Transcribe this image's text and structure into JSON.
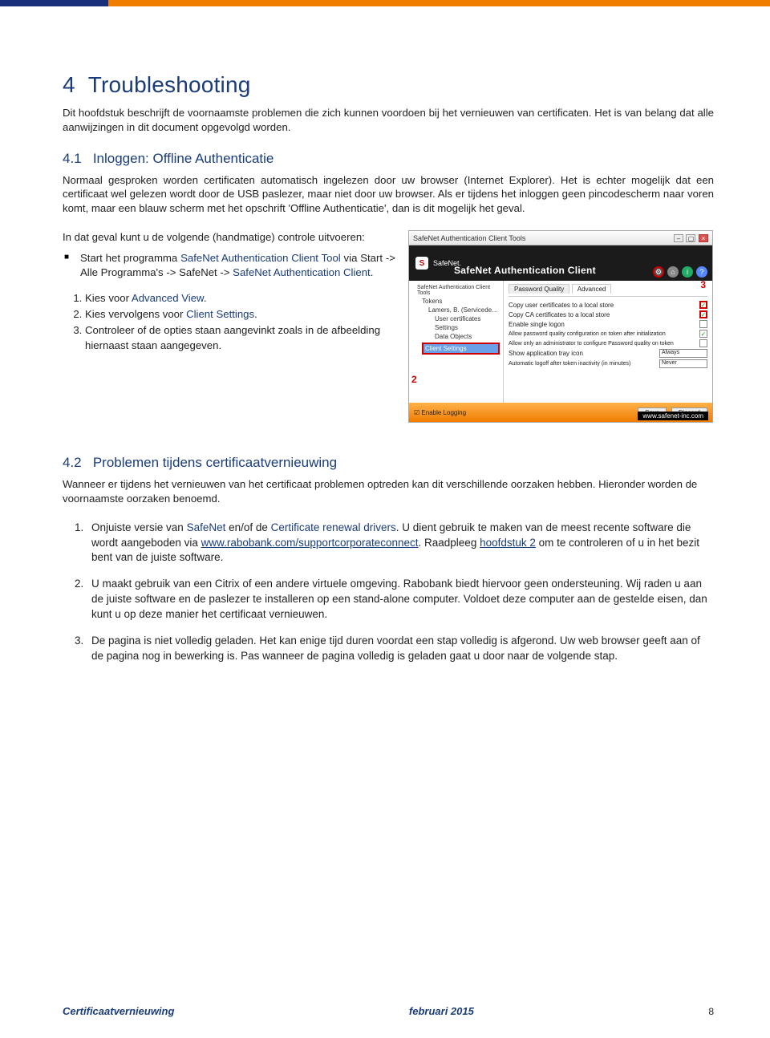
{
  "header": {
    "chapter_number": "4",
    "chapter_title": "Troubleshooting"
  },
  "intro": "Dit hoofdstuk beschrijft de voornaamste problemen die zich kunnen voordoen bij het vernieuwen van certificaten. Het is van belang dat alle aanwijzingen in dit document opgevolgd worden.",
  "s41": {
    "num": "4.1",
    "title": "Inloggen: Offline Authenticatie",
    "p1": "Normaal gesproken worden certificaten automatisch ingelezen door uw browser (Internet Explorer). Het is echter mogelijk dat een certificaat wel gelezen wordt door de USB  paslezer, maar niet door uw browser. Als er tijdens het inloggen geen pincodescherm naar voren komt, maar een blauw scherm met het opschrift 'Offline Authenticatie', dan is dit mogelijk het geval.",
    "lead": "In dat geval kunt u de volgende (handmatige) controle uitvoeren:",
    "bullet_pre": "Start het programma ",
    "bullet_link1": "SafeNet Authentication Client Tool",
    "bullet_mid": " via Start -> Alle Programma's -> SafeNet -> ",
    "bullet_link2": "SafeNet Authentication Client",
    "bullet_post": ".",
    "step1_pre": "Kies voor ",
    "step1_link": "Advanced View",
    "step1_post": ".",
    "step2_pre": "Kies vervolgens voor ",
    "step2_link": "Client Settings",
    "step2_post": ".",
    "step3": "Controleer of de opties staan aangevinkt zoals in de afbeelding hiernaast staan aangegeven."
  },
  "screenshot": {
    "title": "SafeNet Authentication Client Tools",
    "logo": "S",
    "banner": "SafeNet Authentication Client",
    "tree_root": "SafeNet Authentication Client Tools",
    "tree_tokens": "Tokens",
    "tree_card": "Lamers, B. (Servicede…",
    "tree_uc": "User certificates",
    "tree_set": "Settings",
    "tree_do": "Data Objects",
    "tree_cs": "Client Settings",
    "tab1": "Password Quality",
    "tab2": "Advanced",
    "opt1": "Copy user certificates to a local store",
    "opt2": "Copy CA certificates to a local store",
    "opt3": "Enable single logon",
    "opt4": "Allow password quality configuration on token after initialization",
    "opt5": "Allow only an administrator to configure Password quality on token",
    "opt6": "Show application tray icon",
    "opt6v": "Always",
    "opt7": "Automatic logoff after token inactivity (in minutes)",
    "opt7v": "Never",
    "enable_logging": "Enable Logging",
    "btn_save": "Save",
    "btn_discard": "Discard",
    "url": "www.safenet-inc.com",
    "badge2": "2",
    "badge3": "3"
  },
  "s42": {
    "num": "4.2",
    "title": "Problemen tijdens certificaatvernieuwing",
    "p1": "Wanneer er tijdens het vernieuwen van het certificaat problemen optreden kan dit verschillende oorzaken hebben.  Hieronder worden de voornaamste oorzaken benoemd.",
    "li1_pre": "Onjuiste versie van ",
    "li1_a1": "SafeNet",
    "li1_mid1": " en/of de ",
    "li1_a2": "Certificate renewal drivers",
    "li1_mid2": ". U dient gebruik te maken van de meest recente  software die wordt aangeboden via  ",
    "li1_link": "www.rabobank.com/supportcorporateconnect",
    "li1_mid3": ".  Raadpleeg ",
    "li1_a3": "hoofdstuk 2",
    "li1_post": " om te controleren of u in het bezit bent van de juiste software.",
    "li2": "U maakt gebruik van een Citrix of een andere virtuele omgeving. Rabobank biedt hiervoor geen ondersteuning. Wij raden u aan de juiste software en de paslezer te installeren op een stand-alone computer. Voldoet deze computer aan de gestelde eisen, dan kunt u op deze manier het certificaat vernieuwen.",
    "li3": "De pagina is niet volledig geladen. Het kan enige tijd duren voordat een stap volledig is afgerond. Uw web browser geeft aan of de pagina nog in bewerking is. Pas wanneer de pagina volledig is geladen gaat u door naar de volgende stap."
  },
  "footer": {
    "left": "Certificaatvernieuwing",
    "center": "februari 2015",
    "right": "8"
  }
}
